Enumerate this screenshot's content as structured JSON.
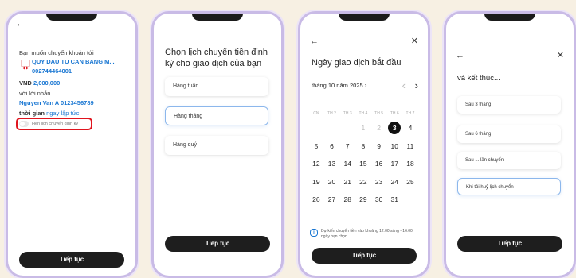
{
  "screen1": {
    "heading": "Bạn muốn chuyển khoản tới",
    "recipient_bank": "QUY DAU TU CAN BANG M...",
    "recipient_account": "002744464001",
    "currency": "VND",
    "amount": "2,000,000",
    "message_label": "với lời nhắn",
    "message": "Nguyen Van A 0123456789",
    "time_label": "thời gian",
    "time_value": "ngay lập tức",
    "schedule_label": "Hẹn lịch chuyển định kỳ",
    "continue": "Tiếp tục"
  },
  "screen2": {
    "title": "Chọn lịch chuyển tiền định kỳ cho giao dịch của bạn",
    "options": [
      "Hàng tuần",
      "Hàng tháng",
      "Hàng quý"
    ],
    "selected": "Hàng tháng",
    "continue": "Tiếp tục"
  },
  "screen3": {
    "title": "Ngày giao dịch bắt đầu",
    "month_label": "tháng 10 năm 2025",
    "weekdays": [
      "CN",
      "TH 2",
      "TH 3",
      "TH 4",
      "TH 5",
      "TH 6",
      "TH 7"
    ],
    "weeks": [
      [
        "",
        "",
        "",
        "1",
        "2",
        "3",
        "4"
      ],
      [
        "5",
        "6",
        "7",
        "8",
        "9",
        "10",
        "11"
      ],
      [
        "12",
        "13",
        "14",
        "15",
        "16",
        "17",
        "18"
      ],
      [
        "19",
        "20",
        "21",
        "22",
        "23",
        "24",
        "25"
      ],
      [
        "26",
        "27",
        "28",
        "29",
        "30",
        "31",
        ""
      ]
    ],
    "dimmed_days": [
      "1",
      "2"
    ],
    "selected_day": "3",
    "note": "Dự kiến chuyển tiền vào khoảng 12:00 sáng - 16:00 ngày bạn chọn",
    "continue": "Tiếp tục"
  },
  "screen4": {
    "title": "và kết thúc...",
    "options": [
      "Sau 3 tháng",
      "Sau 6 tháng",
      "Sau ... lần chuyển",
      "Khi tôi huỷ lịch chuyển"
    ],
    "selected": "Khi tôi huỷ lịch chuyển",
    "continue": "Tiếp tục"
  },
  "colors": {
    "accent_blue": "#1876d2",
    "highlight_red": "#e0141e",
    "button_dark": "#1e1e1e",
    "frame": "#c9bbe6"
  },
  "icons": {
    "back": "arrow-left-icon",
    "close": "close-icon",
    "bank": "bank-logo-icon",
    "info": "info-icon"
  }
}
